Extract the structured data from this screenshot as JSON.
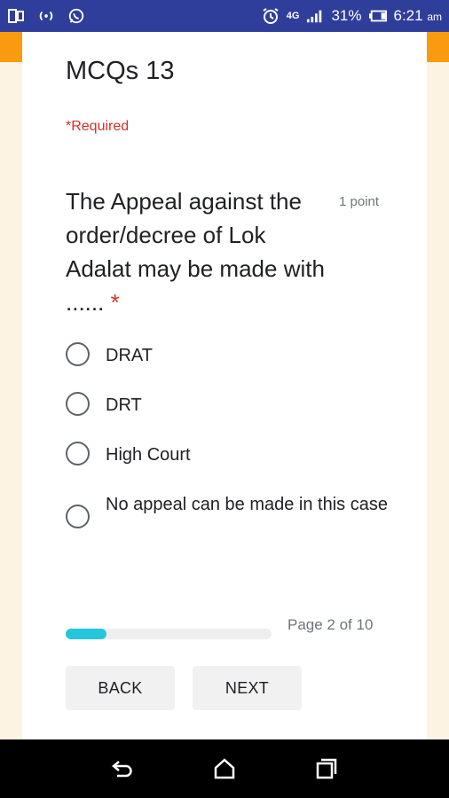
{
  "status_bar": {
    "battery_percent": "31%",
    "time": "6:21",
    "ampm": "am",
    "network": "4G",
    "icons": [
      "screen-cast-icon",
      "hotspot-icon",
      "whatsapp-icon",
      "alarm-icon",
      "network-4g-icon",
      "signal-icon",
      "battery-icon"
    ]
  },
  "form": {
    "title": "MCQs 13",
    "required_note": "*Required"
  },
  "question": {
    "text": "The Appeal against the order/decree of Lok Adalat may be made with ...... ",
    "required_marker": "*",
    "points": "1 point",
    "options": [
      {
        "label": "DRAT"
      },
      {
        "label": "DRT"
      },
      {
        "label": "High Court"
      },
      {
        "label": "No appeal can be made in this case"
      }
    ]
  },
  "progress": {
    "fraction": 0.2,
    "page_text": "Page 2 of 10"
  },
  "buttons": {
    "back": "BACK",
    "next": "NEXT"
  },
  "nav": {
    "icons": [
      "back-icon",
      "home-icon",
      "recents-icon"
    ]
  }
}
